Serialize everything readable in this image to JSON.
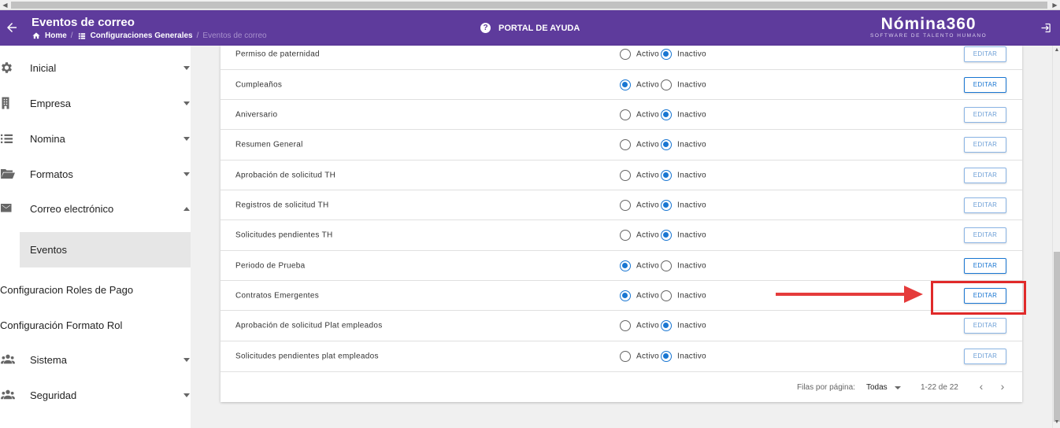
{
  "header": {
    "title": "Eventos de correo",
    "breadcrumb": [
      "Home",
      "Configuraciones Generales",
      "Eventos de correo"
    ],
    "help_label": "PORTAL DE AYUDA",
    "brand": "Nómina360",
    "brand_tagline": "SOFTWARE DE TALENTO HUMANO"
  },
  "sidebar": {
    "items": [
      {
        "label": "Inicial",
        "icon": "gear-icon"
      },
      {
        "label": "Empresa",
        "icon": "building-icon"
      },
      {
        "label": "Nomina",
        "icon": "list-icon"
      },
      {
        "label": "Formatos",
        "icon": "folder-icon"
      },
      {
        "label": "Correo electrónico",
        "icon": "mail-icon"
      },
      {
        "label": "Eventos"
      },
      {
        "label": "Configuracion Roles de Pago"
      },
      {
        "label": "Configuración Formato Rol"
      },
      {
        "label": "Sistema",
        "icon": "people-icon"
      },
      {
        "label": "Seguridad",
        "icon": "people-icon"
      }
    ]
  },
  "table": {
    "active_label": "Activo",
    "inactive_label": "Inactivo",
    "button_label": "EDITAR",
    "rows": [
      {
        "name": "Permiso de paternidad",
        "status": "Inactivo"
      },
      {
        "name": "Cumpleaños",
        "status": "Activo"
      },
      {
        "name": "Aniversario",
        "status": "Inactivo"
      },
      {
        "name": "Resumen General",
        "status": "Inactivo"
      },
      {
        "name": "Aprobación de solicitud TH",
        "status": "Inactivo"
      },
      {
        "name": "Registros de solicitud TH",
        "status": "Inactivo"
      },
      {
        "name": "Solicitudes pendientes TH",
        "status": "Inactivo"
      },
      {
        "name": "Periodo de Prueba",
        "status": "Activo"
      },
      {
        "name": "Contratos Emergentes",
        "status": "Activo"
      },
      {
        "name": "Aprobación de solicitud Plat empleados",
        "status": "Inactivo"
      },
      {
        "name": "Solicitudes pendientes plat empleados",
        "status": "Inactivo"
      }
    ]
  },
  "pagination": {
    "rows_per_page_label": "Filas por página:",
    "rows_per_page_value": "Todas",
    "range": "1-22 de 22"
  },
  "colors": {
    "appbar": "#5e3b9c",
    "accent": "#1976d2",
    "annotation": "#e02a2a"
  }
}
